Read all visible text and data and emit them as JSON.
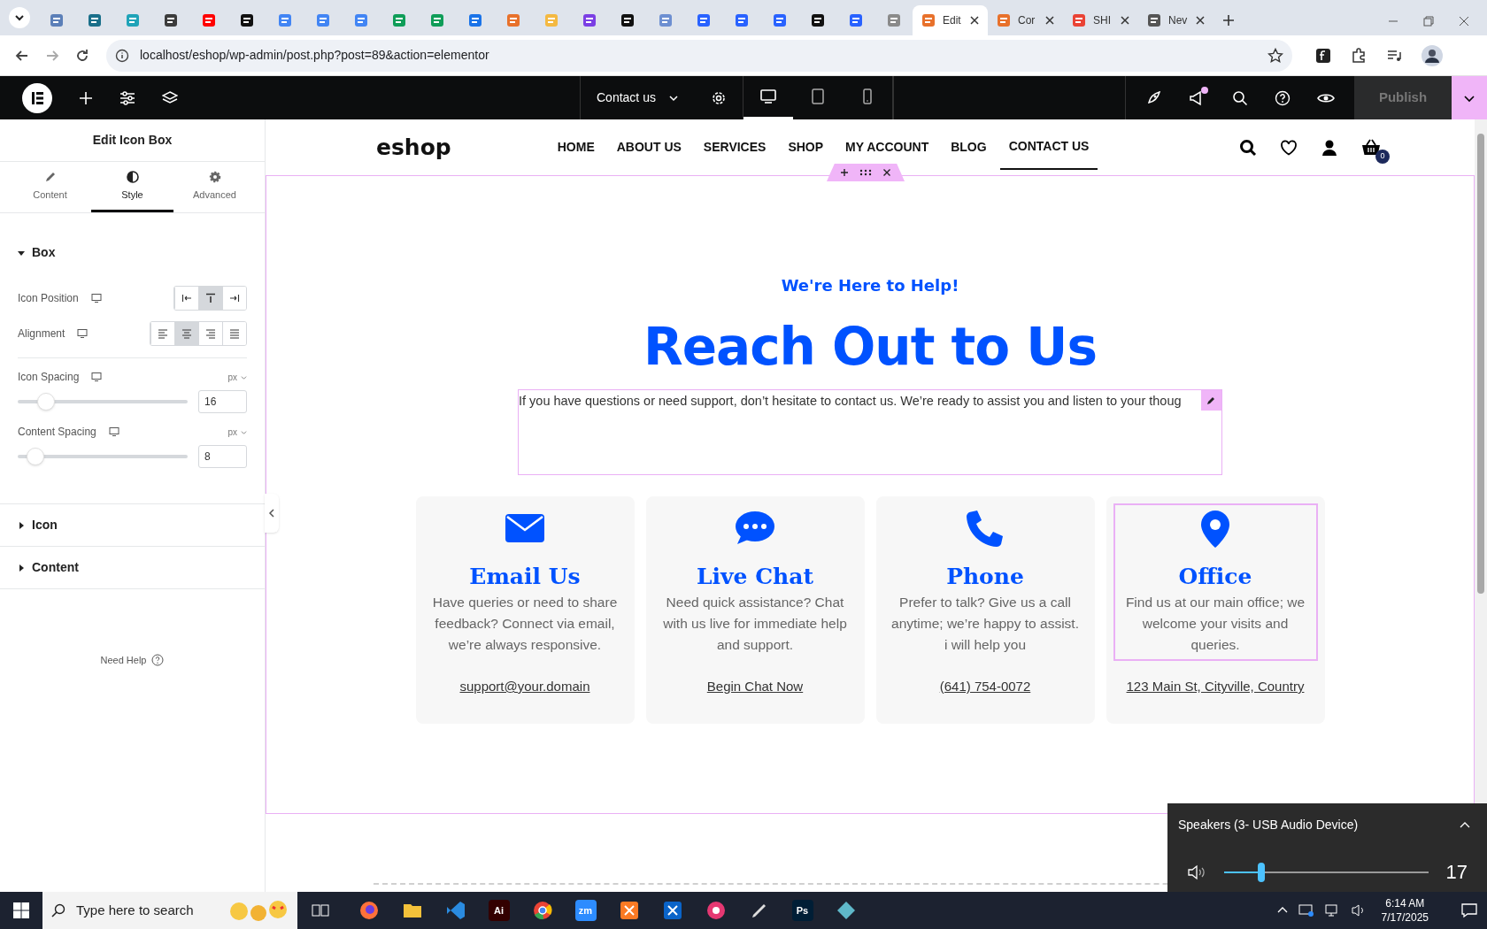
{
  "browser": {
    "tabs": [
      {
        "color": "#5b7fb8",
        "selected": false
      },
      {
        "color": "#1a6f8a",
        "selected": false
      },
      {
        "color": "#1fa3b8",
        "selected": false
      },
      {
        "color": "#3c3c3c",
        "selected": false
      },
      {
        "color": "#ff0000",
        "selected": false
      },
      {
        "color": "#111111",
        "selected": false
      },
      {
        "color": "#4285f4",
        "selected": false
      },
      {
        "color": "#4285f4",
        "selected": false
      },
      {
        "color": "#4285f4",
        "selected": false
      },
      {
        "color": "#0f9d58",
        "selected": false
      },
      {
        "color": "#0f9d58",
        "selected": false
      },
      {
        "color": "#1a73e8",
        "selected": false
      },
      {
        "color": "#e8712b",
        "selected": false
      },
      {
        "color": "#f4b942",
        "selected": false
      },
      {
        "color": "#7b3fe4",
        "selected": false
      },
      {
        "color": "#111111",
        "selected": false
      },
      {
        "color": "#6d8fd1",
        "selected": false
      },
      {
        "color": "#2962ff",
        "selected": false
      },
      {
        "color": "#2962ff",
        "selected": false
      },
      {
        "color": "#2962ff",
        "selected": false
      },
      {
        "color": "#111111",
        "selected": false
      },
      {
        "color": "#2962ff",
        "selected": false
      },
      {
        "color": "#8a8a8a",
        "selected": false
      },
      {
        "label": "Edit",
        "color": "#e8712b",
        "selected": true
      },
      {
        "label": "Cor",
        "color": "#e8712b",
        "selected": false
      },
      {
        "label": "SHI",
        "color": "#ea4335",
        "selected": false
      },
      {
        "label": "Nev",
        "color": "#555555",
        "selected": false
      }
    ],
    "url": "localhost/eshop/wp-admin/post.php?post=89&action=elementor"
  },
  "editor_bar": {
    "page_name": "Contact us",
    "notification": true,
    "devices": [
      {
        "kind": "desktop",
        "selected": true
      },
      {
        "kind": "tablet",
        "selected": false
      },
      {
        "kind": "mobile",
        "selected": false
      }
    ],
    "publish": {
      "label": "Publish",
      "disabled": true
    }
  },
  "panel": {
    "title": "Edit Icon Box",
    "tabs": [
      {
        "kind": "content",
        "label": "Content",
        "selected": false
      },
      {
        "kind": "style",
        "label": "Style",
        "selected": true
      },
      {
        "kind": "advanced",
        "label": "Advanced",
        "selected": false
      }
    ],
    "sections": [
      {
        "title": "Box",
        "expanded": true
      },
      {
        "title": "Icon",
        "expanded": false
      },
      {
        "title": "Content",
        "expanded": false
      }
    ],
    "icon_position": {
      "label": "Icon Position",
      "options": [
        {
          "kind": "left",
          "selected": false
        },
        {
          "kind": "top",
          "selected": true
        },
        {
          "kind": "right",
          "selected": false
        }
      ]
    },
    "alignment": {
      "label": "Alignment",
      "options": [
        {
          "kind": "left",
          "selected": false
        },
        {
          "kind": "center",
          "selected": true
        },
        {
          "kind": "right",
          "selected": false
        },
        {
          "kind": "justify",
          "selected": false
        }
      ]
    },
    "sliders": [
      {
        "label": "Icon Spacing",
        "unit": "px",
        "level": 0.15,
        "value": "16"
      },
      {
        "label": "Content Spacing",
        "unit": "px",
        "level": 0.08,
        "value": "8"
      }
    ],
    "help": "Need Help"
  },
  "site": {
    "logo": "eshop",
    "nav": [
      {
        "label": "HOME",
        "selected": false
      },
      {
        "label": "ABOUT US",
        "selected": false
      },
      {
        "label": "SERVICES",
        "selected": false
      },
      {
        "label": "SHOP",
        "selected": false
      },
      {
        "label": "MY ACCOUNT",
        "selected": false
      },
      {
        "label": "BLOG",
        "selected": false
      },
      {
        "label": "CONTACT US",
        "selected": true
      }
    ],
    "cart_count": "0",
    "subtitle": "We're Here to Help!",
    "heading": "Reach Out to Us",
    "intro": "If you have questions or need support, don’t hesitate to contact us. We’re ready to assist you and listen to your thoug",
    "cards": [
      {
        "kind": "email",
        "title": "Email Us",
        "text": "Have queries or need to share feedback? Connect via email, we’re always responsive.",
        "link": "support@your.domain",
        "selected": false
      },
      {
        "kind": "chat",
        "title": "Live Chat",
        "text": "Need quick assistance? Chat with us live for immediate help and support.",
        "link": "Begin Chat Now",
        "selected": false
      },
      {
        "kind": "phone",
        "title": "Phone",
        "text": "Prefer to talk? Give us a call anytime; we’re happy to assist. i will help you",
        "link": "(641) 754-0072",
        "selected": false
      },
      {
        "kind": "pin",
        "title": "Office",
        "text": "Find us at our main office; we welcome your visits and queries.",
        "link": "123 Main St, Cityville, Country",
        "selected": true
      }
    ]
  },
  "volume": {
    "device": "Speakers (3- USB Audio Device)",
    "level": 0.18,
    "reading": "17"
  },
  "taskbar": {
    "search_placeholder": "Type here to search",
    "apps": [
      {
        "kind": "firefox",
        "color": "#ff7139"
      },
      {
        "kind": "folder",
        "color": "#f3c13a"
      },
      {
        "kind": "code",
        "color": "#2a8be0"
      },
      {
        "kind": "glyph",
        "color": "#330000",
        "glyph": "Ai"
      },
      {
        "kind": "chrome",
        "color": "#ea4335"
      },
      {
        "kind": "glyph",
        "color": "#2d8cff",
        "glyph": "zm"
      },
      {
        "kind": "square",
        "color": "#fb7a24"
      },
      {
        "kind": "square",
        "color": "#0a64c9"
      },
      {
        "kind": "circle",
        "color": "#e53872"
      },
      {
        "kind": "pen",
        "color": "#dddddd"
      },
      {
        "kind": "glyph",
        "color": "#001e36",
        "glyph": "Ps"
      },
      {
        "kind": "diamond",
        "color": "#5fb8c9"
      }
    ],
    "time": "6:14 AM",
    "date": "7/17/2025"
  }
}
